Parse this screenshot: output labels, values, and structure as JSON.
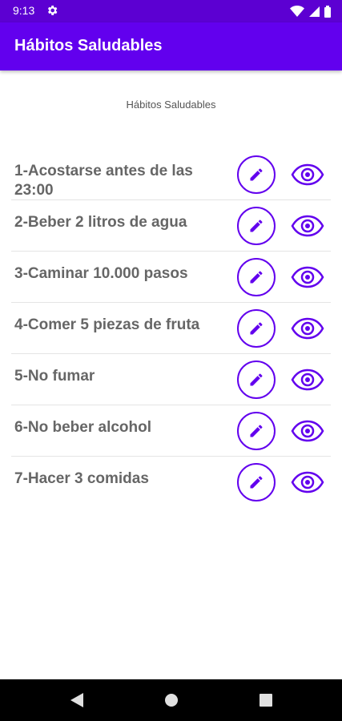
{
  "status_bar": {
    "time": "9:13"
  },
  "app_bar": {
    "title": "Hábitos Saludables"
  },
  "subtitle": "Hábitos Saludables",
  "habits": [
    {
      "label": "1-Acostarse antes de las 23:00"
    },
    {
      "label": "2-Beber 2 litros de agua"
    },
    {
      "label": "3-Caminar 10.000 pasos"
    },
    {
      "label": "4-Comer 5 piezas de fruta"
    },
    {
      "label": "5-No fumar"
    },
    {
      "label": "6-No beber alcohol"
    },
    {
      "label": "7-Hacer 3 comidas"
    }
  ],
  "icons": {
    "edit": "pencil-icon",
    "view": "eye-icon",
    "settings": "gear-icon",
    "wifi": "wifi-icon",
    "signal": "signal-icon",
    "battery": "battery-icon",
    "back": "back-icon",
    "home": "home-icon",
    "recents": "recents-icon"
  },
  "colors": {
    "primary": "#6200ee",
    "status_bar": "#5c00d2",
    "label_text": "#666666"
  }
}
